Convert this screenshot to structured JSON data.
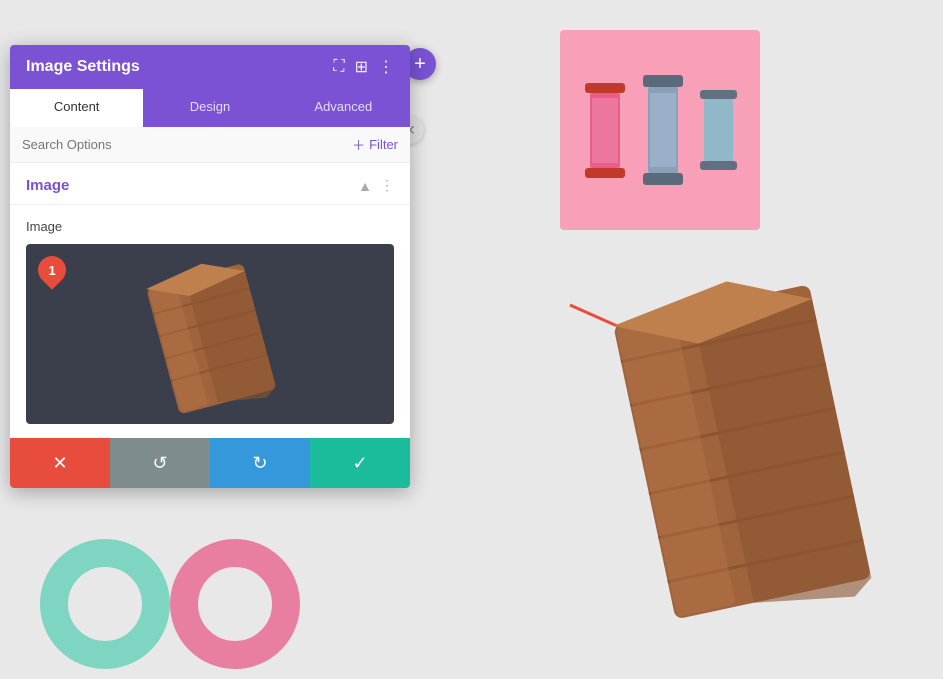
{
  "panel": {
    "title": "Image Settings",
    "tabs": [
      {
        "id": "content",
        "label": "Content",
        "active": true
      },
      {
        "id": "design",
        "label": "Design",
        "active": false
      },
      {
        "id": "advanced",
        "label": "Advanced",
        "active": false
      }
    ],
    "search": {
      "placeholder": "Search Options",
      "filter_label": "Filter"
    },
    "section": {
      "title": "Image",
      "label": "Image"
    },
    "badge": "1",
    "toolbar": {
      "cancel_icon": "✕",
      "undo_icon": "↺",
      "redo_icon": "↻",
      "confirm_icon": "✓"
    }
  },
  "add_button": "+",
  "colors": {
    "purple": "#7b52d3",
    "red": "#e74c3c",
    "gray": "#7f8c8d",
    "blue": "#3498db",
    "green": "#1abc9c"
  }
}
